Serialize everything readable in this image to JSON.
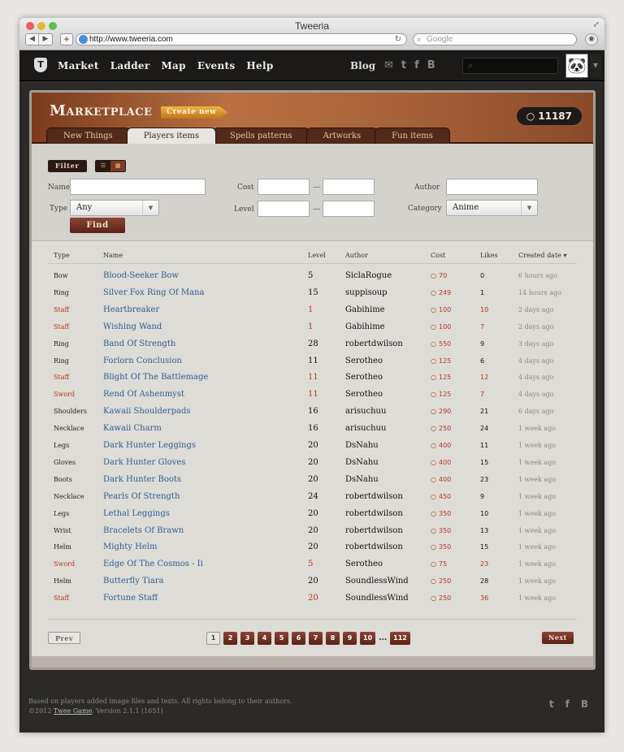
{
  "browser": {
    "title": "Tweeria",
    "url": "http://www.tweeria.com",
    "search_placeholder": "Google"
  },
  "nav": {
    "logo": "T",
    "items": [
      "Market",
      "Ladder",
      "Map",
      "Events",
      "Help"
    ],
    "blog": "Blog"
  },
  "header": {
    "title": "Marketplace",
    "create_new": "Create new",
    "coins": "11187"
  },
  "tabs": [
    "New Things",
    "Players items",
    "Spells patterns",
    "Artworks",
    "Fun items"
  ],
  "active_tab": 1,
  "filters": {
    "filter_label": "Filter",
    "name_label": "Name",
    "type_label": "Type",
    "type_value": "Any",
    "cost_label": "Cost",
    "level_label": "Level",
    "author_label": "Author",
    "category_label": "Category",
    "category_value": "Anime",
    "find": "Find",
    "dash": "—"
  },
  "table": {
    "headers": {
      "type": "Type",
      "name": "Name",
      "level": "Level",
      "author": "Author",
      "cost": "Cost",
      "likes": "Likes",
      "created": "Created date ▾"
    },
    "rows": [
      {
        "type": "Bow",
        "name": "Blood-Seeker Bow",
        "level": "5",
        "author": "SiclaRogue",
        "cost": "70",
        "likes": "0",
        "date": "6 hours ago",
        "red": false
      },
      {
        "type": "Ring",
        "name": "Silver Fox Ring Of Mana",
        "level": "15",
        "author": "suppisoup",
        "cost": "249",
        "likes": "1",
        "date": "14 hours ago",
        "red": false
      },
      {
        "type": "Staff",
        "name": "Heartbreaker",
        "level": "1",
        "author": "Gabihime",
        "cost": "100",
        "likes": "10",
        "date": "2 days ago",
        "red": true
      },
      {
        "type": "Staff",
        "name": "Wishing Wand",
        "level": "1",
        "author": "Gabihime",
        "cost": "100",
        "likes": "7",
        "date": "2 days ago",
        "red": true
      },
      {
        "type": "Ring",
        "name": "Band Of Strength",
        "level": "28",
        "author": "robertdwilson",
        "cost": "550",
        "likes": "9",
        "date": "3 days ago",
        "red": false
      },
      {
        "type": "Ring",
        "name": "Forlorn Conclusion",
        "level": "11",
        "author": "Serotheo",
        "cost": "125",
        "likes": "6",
        "date": "4 days ago",
        "red": false
      },
      {
        "type": "Staff",
        "name": "Blight Of The Battlemage",
        "level": "11",
        "author": "Serotheo",
        "cost": "125",
        "likes": "12",
        "date": "4 days ago",
        "red": true
      },
      {
        "type": "Sword",
        "name": "Rend Of Ashenmyst",
        "level": "11",
        "author": "Serotheo",
        "cost": "125",
        "likes": "7",
        "date": "4 days ago",
        "red": true
      },
      {
        "type": "Shoulders",
        "name": "Kawaii Shoulderpads",
        "level": "16",
        "author": "arisuchuu",
        "cost": "290",
        "likes": "21",
        "date": "6 days ago",
        "red": false
      },
      {
        "type": "Necklace",
        "name": "Kawaii Charm",
        "level": "16",
        "author": "arisuchuu",
        "cost": "250",
        "likes": "24",
        "date": "1 week ago",
        "red": false
      },
      {
        "type": "Legs",
        "name": "Dark Hunter Leggings",
        "level": "20",
        "author": "DsNahu",
        "cost": "400",
        "likes": "11",
        "date": "1 week ago",
        "red": false
      },
      {
        "type": "Gloves",
        "name": "Dark Hunter Gloves",
        "level": "20",
        "author": "DsNahu",
        "cost": "400",
        "likes": "15",
        "date": "1 week ago",
        "red": false
      },
      {
        "type": "Boots",
        "name": "Dark Hunter Boots",
        "level": "20",
        "author": "DsNahu",
        "cost": "400",
        "likes": "23",
        "date": "1 week ago",
        "red": false
      },
      {
        "type": "Necklace",
        "name": "Pearls Of Strength",
        "level": "24",
        "author": "robertdwilson",
        "cost": "450",
        "likes": "9",
        "date": "1 week ago",
        "red": false
      },
      {
        "type": "Legs",
        "name": "Lethal Leggings",
        "level": "20",
        "author": "robertdwilson",
        "cost": "350",
        "likes": "10",
        "date": "1 week ago",
        "red": false
      },
      {
        "type": "Wrist",
        "name": "Bracelets Of Brawn",
        "level": "20",
        "author": "robertdwilson",
        "cost": "350",
        "likes": "13",
        "date": "1 week ago",
        "red": false
      },
      {
        "type": "Helm",
        "name": "Mighty Helm",
        "level": "20",
        "author": "robertdwilson",
        "cost": "350",
        "likes": "15",
        "date": "1 week ago",
        "red": false
      },
      {
        "type": "Sword",
        "name": "Edge Of The Cosmos - Ii",
        "level": "5",
        "author": "Serotheo",
        "cost": "75",
        "likes": "23",
        "date": "1 week ago",
        "red": true
      },
      {
        "type": "Helm",
        "name": "Butterfly Tiara",
        "level": "20",
        "author": "SoundlessWind",
        "cost": "250",
        "likes": "28",
        "date": "1 week ago",
        "red": false
      },
      {
        "type": "Staff",
        "name": "Fortune Staff",
        "level": "20",
        "author": "SoundlessWind",
        "cost": "250",
        "likes": "36",
        "date": "1 week ago",
        "red": true
      }
    ]
  },
  "pagination": {
    "prev": "Prev",
    "next": "Next",
    "pages": [
      "1",
      "2",
      "3",
      "4",
      "5",
      "6",
      "7",
      "8",
      "9",
      "10"
    ],
    "ellipsis": "…",
    "last": "112",
    "current": "1"
  },
  "footer": {
    "line1": "Based on players added image files and texts. All rights belong to their authors.",
    "line2_prefix": "©2012 ",
    "line2_link": "Twee Game",
    "line2_suffix": ". Version 2.1.1 (1651)"
  },
  "icons": {
    "mail": "✉",
    "twitter": "t",
    "facebook": "f",
    "blog_b": "B",
    "coin": "○"
  }
}
